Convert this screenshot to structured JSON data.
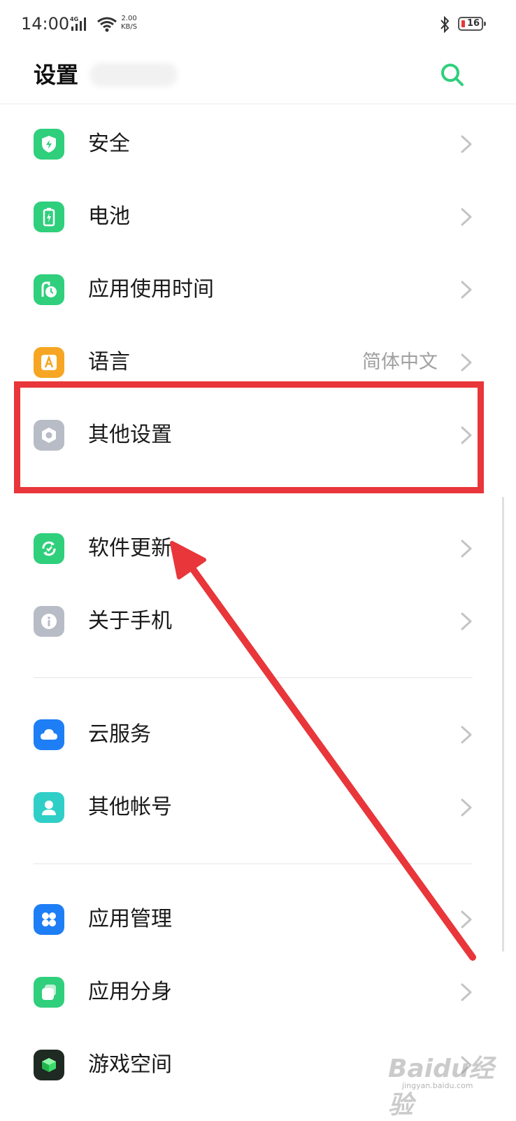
{
  "status_bar": {
    "time": "14:00",
    "network": "4G",
    "speed_value": "2.00",
    "speed_unit": "KB/S",
    "battery": "16"
  },
  "header": {
    "title": "设置"
  },
  "colors": {
    "accent": "#2fcf7c",
    "annotation": "#e8363a",
    "chevron": "#c4c4c4",
    "value_text": "#a0a0a0"
  },
  "settings": {
    "items": [
      {
        "label": "安全",
        "icon": "shield-icon",
        "color": "#2fcf7c"
      },
      {
        "label": "电池",
        "icon": "battery-icon",
        "color": "#2fcf7c"
      },
      {
        "label": "应用使用时间",
        "icon": "app-usage-time-icon",
        "color": "#2fcf7c"
      },
      {
        "label": "语言",
        "icon": "language-icon",
        "color": "#f6a623",
        "value": "简体中文"
      },
      {
        "label": "其他设置",
        "icon": "hexagon-settings-icon",
        "color": "#b7bcc6"
      },
      {
        "label": "软件更新",
        "icon": "update-icon",
        "color": "#2fcf7c"
      },
      {
        "label": "关于手机",
        "icon": "info-icon",
        "color": "#b7bcc6"
      },
      {
        "label": "云服务",
        "icon": "cloud-icon",
        "color": "#1e7ef5"
      },
      {
        "label": "其他帐号",
        "icon": "person-icon",
        "color": "#2fcfc8"
      },
      {
        "label": "应用管理",
        "icon": "app-grid-icon",
        "color": "#1e7ef5"
      },
      {
        "label": "应用分身",
        "icon": "app-clone-icon",
        "color": "#2fcf7c"
      },
      {
        "label": "游戏空间",
        "icon": "game-cube-icon",
        "color": "#1f2a22"
      }
    ]
  },
  "watermark": {
    "text": "Baidu经验",
    "sub": "jingyan.baidu.com"
  }
}
